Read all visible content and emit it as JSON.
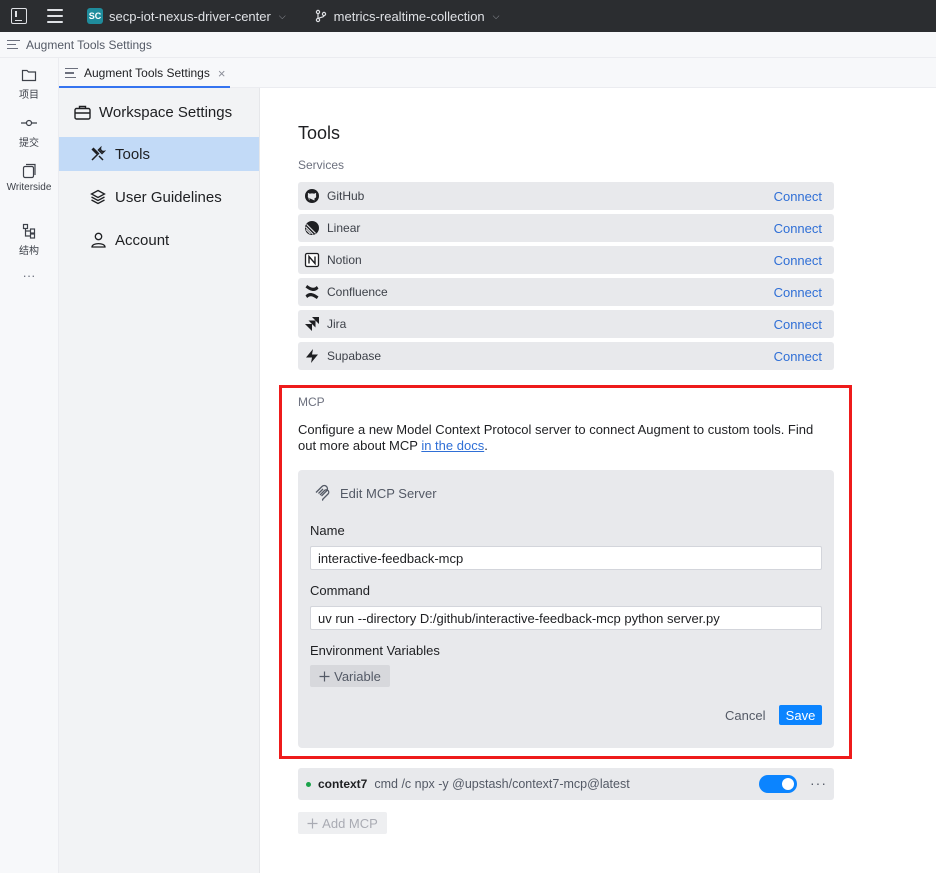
{
  "titlebar": {
    "project_badge": "SC",
    "project_name": "secp-iot-nexus-driver-center",
    "branch_name": "metrics-realtime-collection"
  },
  "breadcrumb": {
    "title": "Augment Tools Settings"
  },
  "toolstrip": {
    "items": [
      {
        "label": "项目",
        "icon": "folder-icon"
      },
      {
        "label": "提交",
        "icon": "commit-icon"
      },
      {
        "label": "Writerside",
        "icon": "writerside-icon"
      },
      {
        "label": "结构",
        "icon": "structure-icon"
      },
      {
        "label": "···",
        "icon": "more-icon"
      }
    ]
  },
  "tab": {
    "label": "Augment Tools Settings",
    "close": "×"
  },
  "nav": {
    "items": [
      {
        "label": "Workspace Settings",
        "icon": "briefcase-icon"
      },
      {
        "label": "Tools",
        "icon": "tools-icon"
      },
      {
        "label": "User Guidelines",
        "icon": "layers-icon"
      },
      {
        "label": "Account",
        "icon": "user-icon"
      }
    ]
  },
  "main": {
    "title": "Tools",
    "services_label": "Services",
    "services": [
      {
        "name": "GitHub",
        "icon": "github-icon",
        "action": "Connect"
      },
      {
        "name": "Linear",
        "icon": "linear-icon",
        "action": "Connect"
      },
      {
        "name": "Notion",
        "icon": "notion-icon",
        "action": "Connect"
      },
      {
        "name": "Confluence",
        "icon": "confluence-icon",
        "action": "Connect"
      },
      {
        "name": "Jira",
        "icon": "jira-icon",
        "action": "Connect"
      },
      {
        "name": "Supabase",
        "icon": "supabase-icon",
        "action": "Connect"
      }
    ],
    "mcp": {
      "label": "MCP",
      "description": "Configure a new Model Context Protocol server to connect Augment to custom tools. Find out more about MCP ",
      "docs_link": "in the docs",
      "period": ".",
      "edit": {
        "title": "Edit MCP Server",
        "name_label": "Name",
        "name_value": "interactive-feedback-mcp",
        "command_label": "Command",
        "command_value": "uv run --directory D:/github/interactive-feedback-mcp python server.py",
        "env_label": "Environment Variables",
        "variable_button": "Variable",
        "cancel": "Cancel",
        "save": "Save"
      },
      "servers": [
        {
          "name": "context7",
          "command": "cmd /c npx -y @upstash/context7-mcp@latest",
          "enabled": true,
          "status_color": "#1aa34a"
        }
      ],
      "add_button": "Add MCP",
      "more": "···"
    }
  },
  "colors": {
    "accent": "#0b84ff",
    "link": "#2f6fd6",
    "highlight": "#ee1b1b",
    "nav_active": "#c2daf7"
  }
}
